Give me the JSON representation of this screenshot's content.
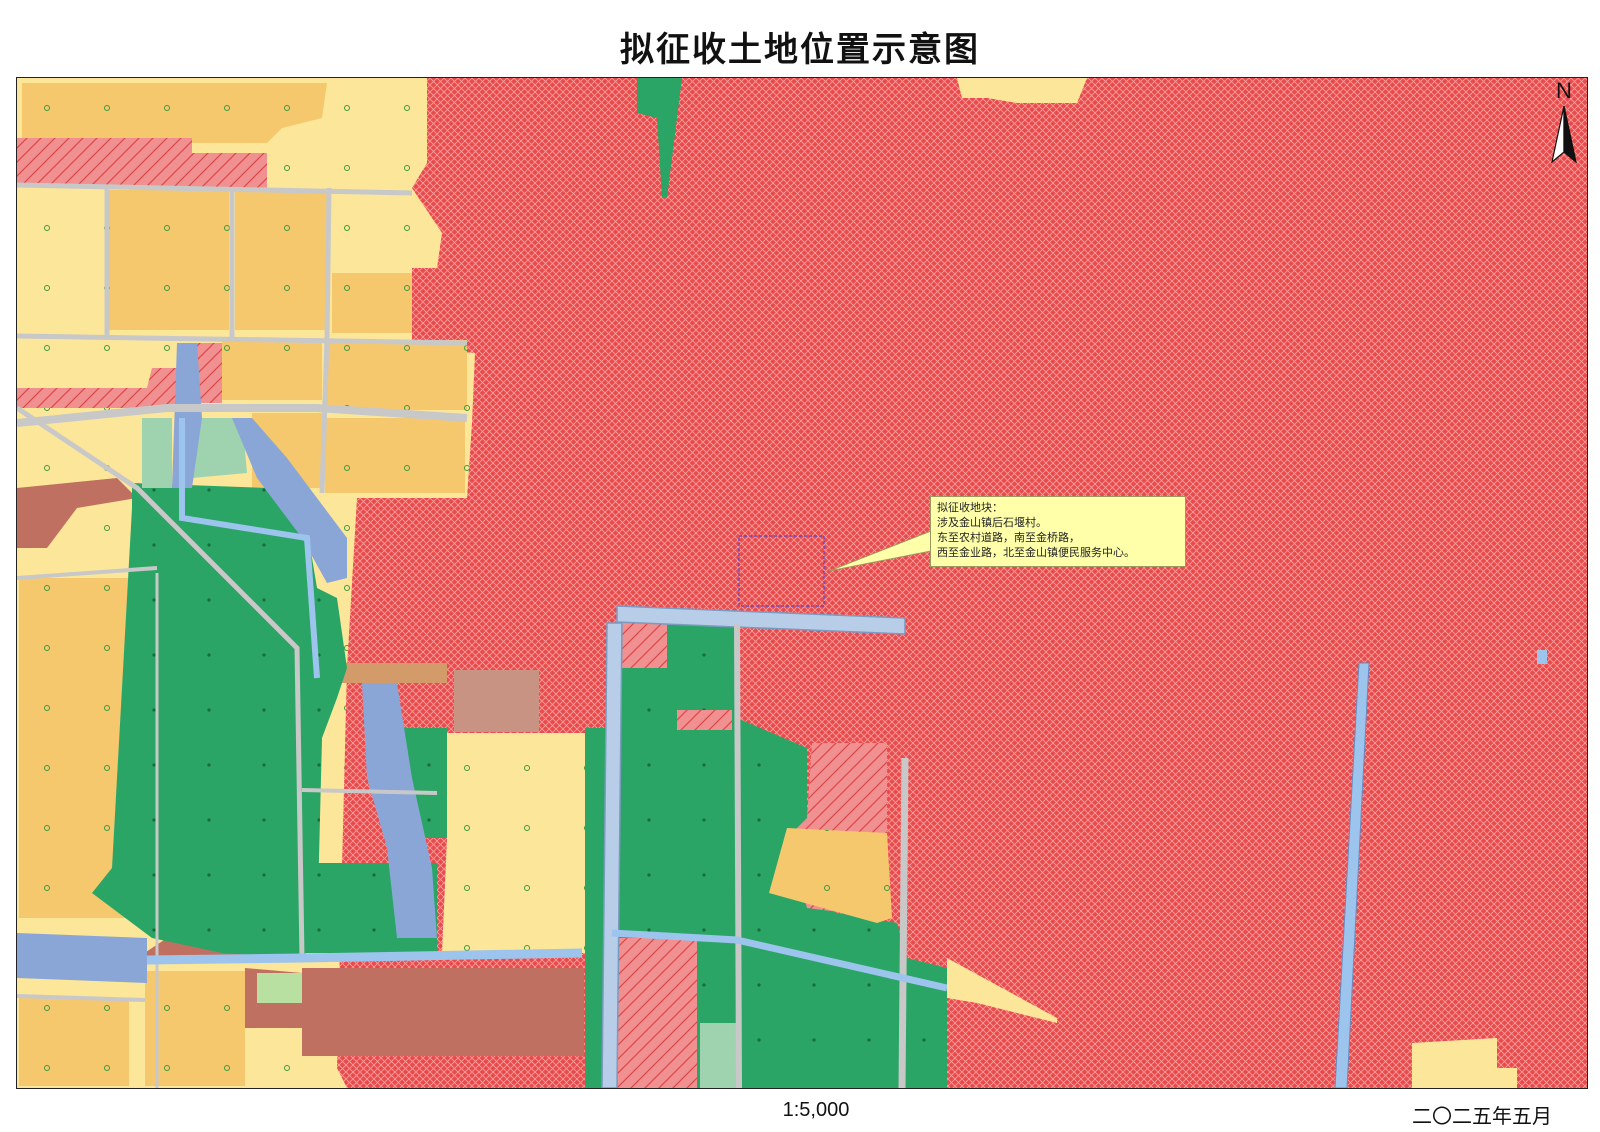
{
  "title": "拟征收土地位置示意图",
  "callout": {
    "line1": "拟征收地块：",
    "line2": "涉及金山镇后石堰村。",
    "line3": "东至农村道路，南至金桥路，",
    "line4": "西至金业路，北至金山镇便民服务中心。"
  },
  "north_label": "N",
  "scale": "1:5,000",
  "date": "二〇二五年五月",
  "colors": {
    "construction_red": "#e84b4b",
    "hatch": "#ff9a9a",
    "cropland_light": "#fce69a",
    "cropland_orange": "#f5c86e",
    "forest_green": "#2aa566",
    "water_blue": "#8aa6d6",
    "road_gray": "#c8c8c8",
    "brown": "#c07060",
    "light_green": "#9fd3b0",
    "tan": "#c99384"
  }
}
